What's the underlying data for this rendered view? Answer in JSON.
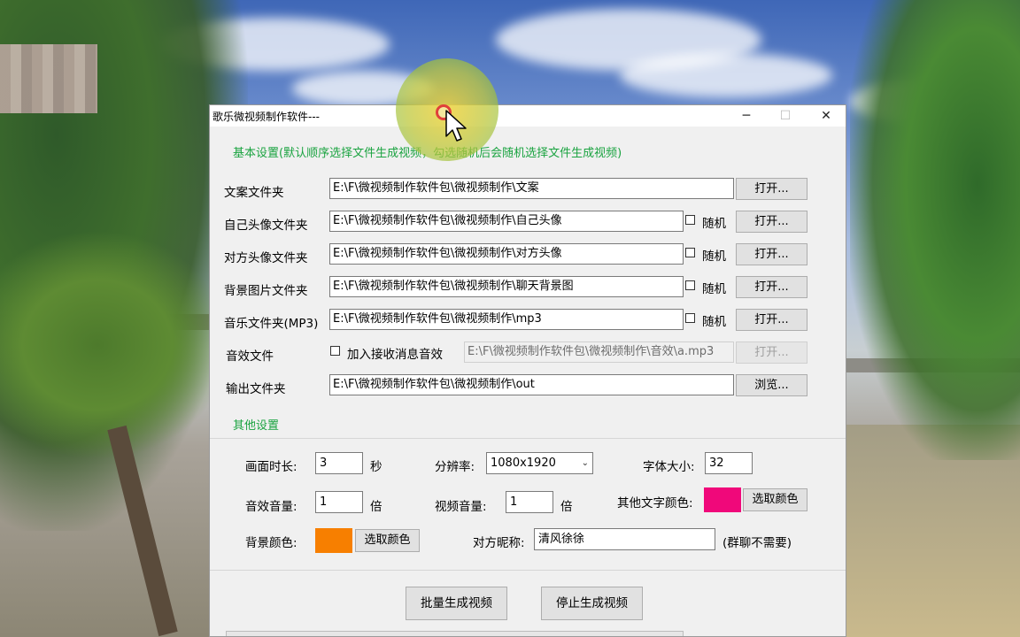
{
  "window": {
    "title": "歌乐微视频制作软件---",
    "controls": {
      "minimize": "─",
      "maximize": "☐",
      "close": "✕"
    }
  },
  "basic": {
    "section_title": "基本设置(默认顺序选择文件生成视频，勾选随机后会随机选择文件生成视频)",
    "rows": [
      {
        "label": "文案文件夹",
        "path": "E:\\F\\微视频制作软件包\\微视频制作\\文案",
        "button": "打开..."
      },
      {
        "label": "自己头像文件夹",
        "path": "E:\\F\\微视频制作软件包\\微视频制作\\自己头像",
        "random_label": "随机",
        "button": "打开..."
      },
      {
        "label": "对方头像文件夹",
        "path": "E:\\F\\微视频制作软件包\\微视频制作\\对方头像",
        "random_label": "随机",
        "button": "打开..."
      },
      {
        "label": "背景图片文件夹",
        "path": "E:\\F\\微视频制作软件包\\微视频制作\\聊天背景图",
        "random_label": "随机",
        "button": "打开..."
      },
      {
        "label": "音乐文件夹(MP3)",
        "path": "E:\\F\\微视频制作软件包\\微视频制作\\mp3",
        "random_label": "随机",
        "button": "打开..."
      }
    ],
    "sound": {
      "label": "音效文件",
      "checkbox_label": "加入接收消息音效",
      "path": "E:\\F\\微视频制作软件包\\微视频制作\\音效\\a.mp3",
      "button": "打开..."
    },
    "output": {
      "label": "输出文件夹",
      "path": "E:\\F\\微视频制作软件包\\微视频制作\\out",
      "button": "浏览..."
    }
  },
  "other": {
    "section_title": "其他设置",
    "duration": {
      "label": "画面时长:",
      "value": "3",
      "unit": "秒"
    },
    "resolution": {
      "label": "分辨率:",
      "value": "1080x1920"
    },
    "font_size": {
      "label": "字体大小:",
      "value": "32"
    },
    "effect_volume": {
      "label": "音效音量:",
      "value": "1",
      "unit": "倍"
    },
    "video_volume": {
      "label": "视频音量:",
      "value": "1",
      "unit": "倍"
    },
    "text_color": {
      "label": "其他文字颜色:",
      "color": "#f0087a",
      "button": "选取颜色"
    },
    "bg_color": {
      "label": "背景颜色:",
      "color": "#f77f00",
      "button": "选取颜色"
    },
    "nickname": {
      "label": "对方昵称:",
      "value": "清风徐徐",
      "note": "(群聊不需要)"
    }
  },
  "actions": {
    "batch": "批量生成视频",
    "stop": "停止生成视频"
  },
  "colors": {
    "section_green": "#1aa340"
  }
}
